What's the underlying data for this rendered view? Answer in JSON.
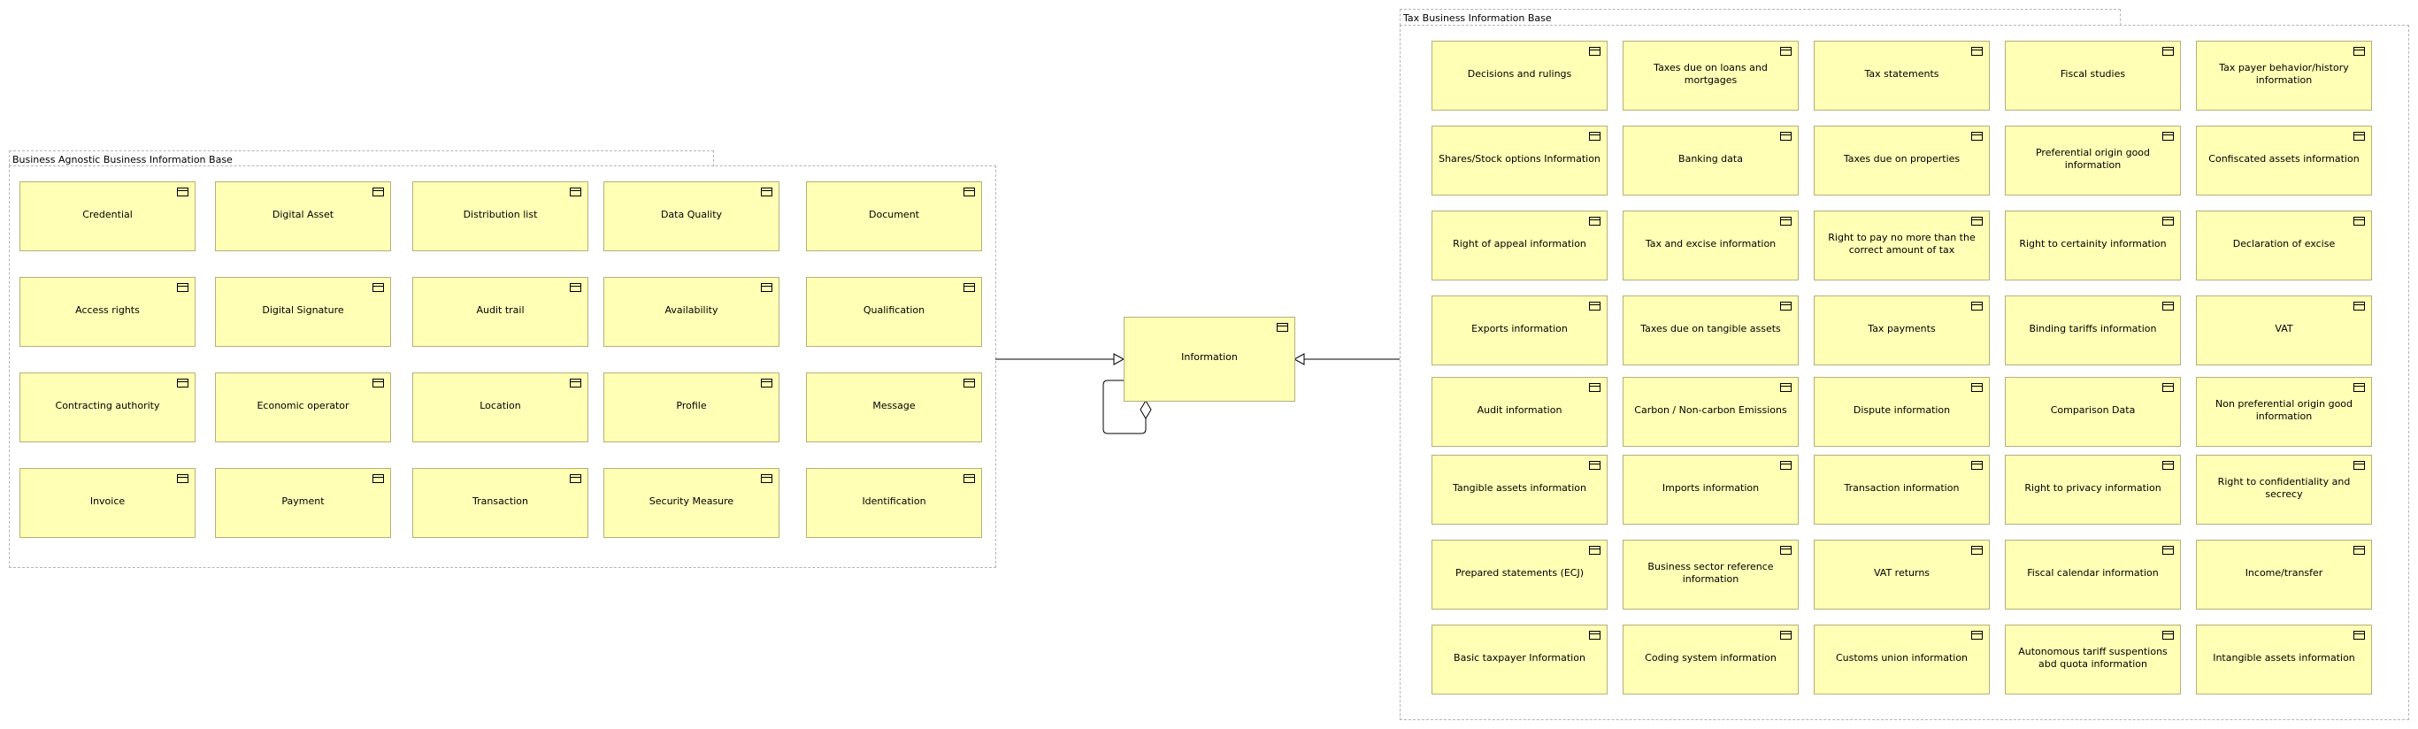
{
  "diagram": {
    "colors": {
      "box_fill": "#ffffb5",
      "box_border": "#b5b07a",
      "group_border": "#b4b4b4",
      "line": "#000000"
    },
    "left_group": {
      "title": "Business Agnostic Business Information Base",
      "rows": [
        [
          "Credential",
          "Digital Asset",
          "Distribution list",
          "Data Quality",
          "Document"
        ],
        [
          "Access rights",
          "Digital Signature",
          "Audit trail",
          "Availability",
          "Qualification"
        ],
        [
          "Contracting authority",
          "Economic operator",
          "Location",
          "Profile",
          "Message"
        ],
        [
          "Invoice",
          "Payment",
          "Transaction",
          "Security Measure",
          "Identification"
        ]
      ]
    },
    "center": {
      "label": "Information",
      "relations": [
        {
          "from": "Business Agnostic Business Information Base",
          "to": "Information",
          "type": "specialization"
        },
        {
          "from": "Tax Business Information Base",
          "to": "Information",
          "type": "specialization"
        },
        {
          "from": "Information",
          "to": "Information",
          "type": "aggregation"
        }
      ]
    },
    "right_group": {
      "title": "Tax Business Information Base",
      "rows": [
        [
          "Decisions and rulings",
          "Taxes due on loans and mortgages",
          "Tax statements",
          "Fiscal studies",
          "Tax payer behavior/history information"
        ],
        [
          "Shares/Stock options Information",
          "Banking data",
          "Taxes due on properties",
          "Preferential origin good information",
          "Confiscated assets information"
        ],
        [
          "Right of appeal information",
          "Tax and excise information",
          "Right to pay no more than the correct amount of tax",
          "Right to certainity information",
          "Declaration of excise"
        ],
        [
          "Exports information",
          "Taxes due on tangible assets",
          "Tax payments",
          "Binding tariffs information",
          "VAT"
        ],
        [
          "Audit information",
          "Carbon / Non-carbon Emissions",
          "Dispute information",
          "Comparison Data",
          "Non preferential origin good information"
        ],
        [
          "Tangible assets information",
          "Imports information",
          "Transaction information",
          "Right to privacy information",
          "Right to confidentiality and secrecy"
        ],
        [
          "Prepared statements (ECJ)",
          "Business sector reference information",
          "VAT returns",
          "Fiscal calendar information",
          "Income/transfer"
        ],
        [
          "Basic taxpayer Information",
          "Coding system information",
          "Customs union information",
          "Autonomous tariff suspentions abd quota information",
          "Intangible assets information"
        ]
      ]
    }
  }
}
